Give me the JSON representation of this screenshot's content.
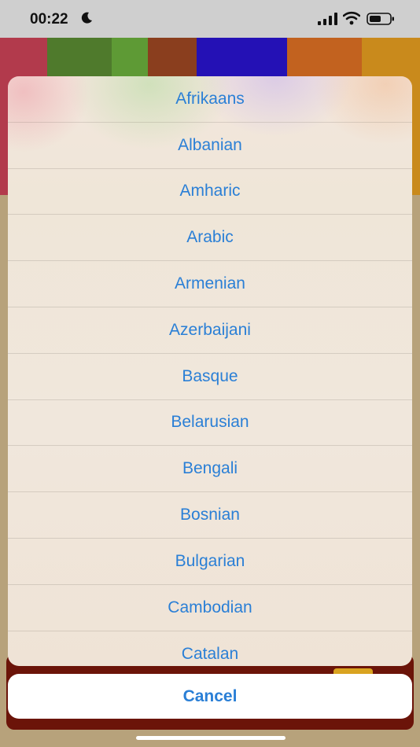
{
  "status_bar": {
    "time": "00:22",
    "icons": [
      "moon-icon",
      "signal-icon",
      "wifi-icon",
      "battery-icon"
    ]
  },
  "action_sheet": {
    "items": [
      "Afrikaans",
      "Albanian",
      "Amharic",
      "Arabic",
      "Armenian",
      "Azerbaijani",
      "Basque",
      "Belarusian",
      "Bengali",
      "Bosnian",
      "Bulgarian",
      "Cambodian",
      "Catalan"
    ],
    "cancel_label": "Cancel"
  },
  "colors": {
    "accent": "#2a7fd6",
    "tab_bar": "#6b1409",
    "background": "#b7a27b"
  }
}
